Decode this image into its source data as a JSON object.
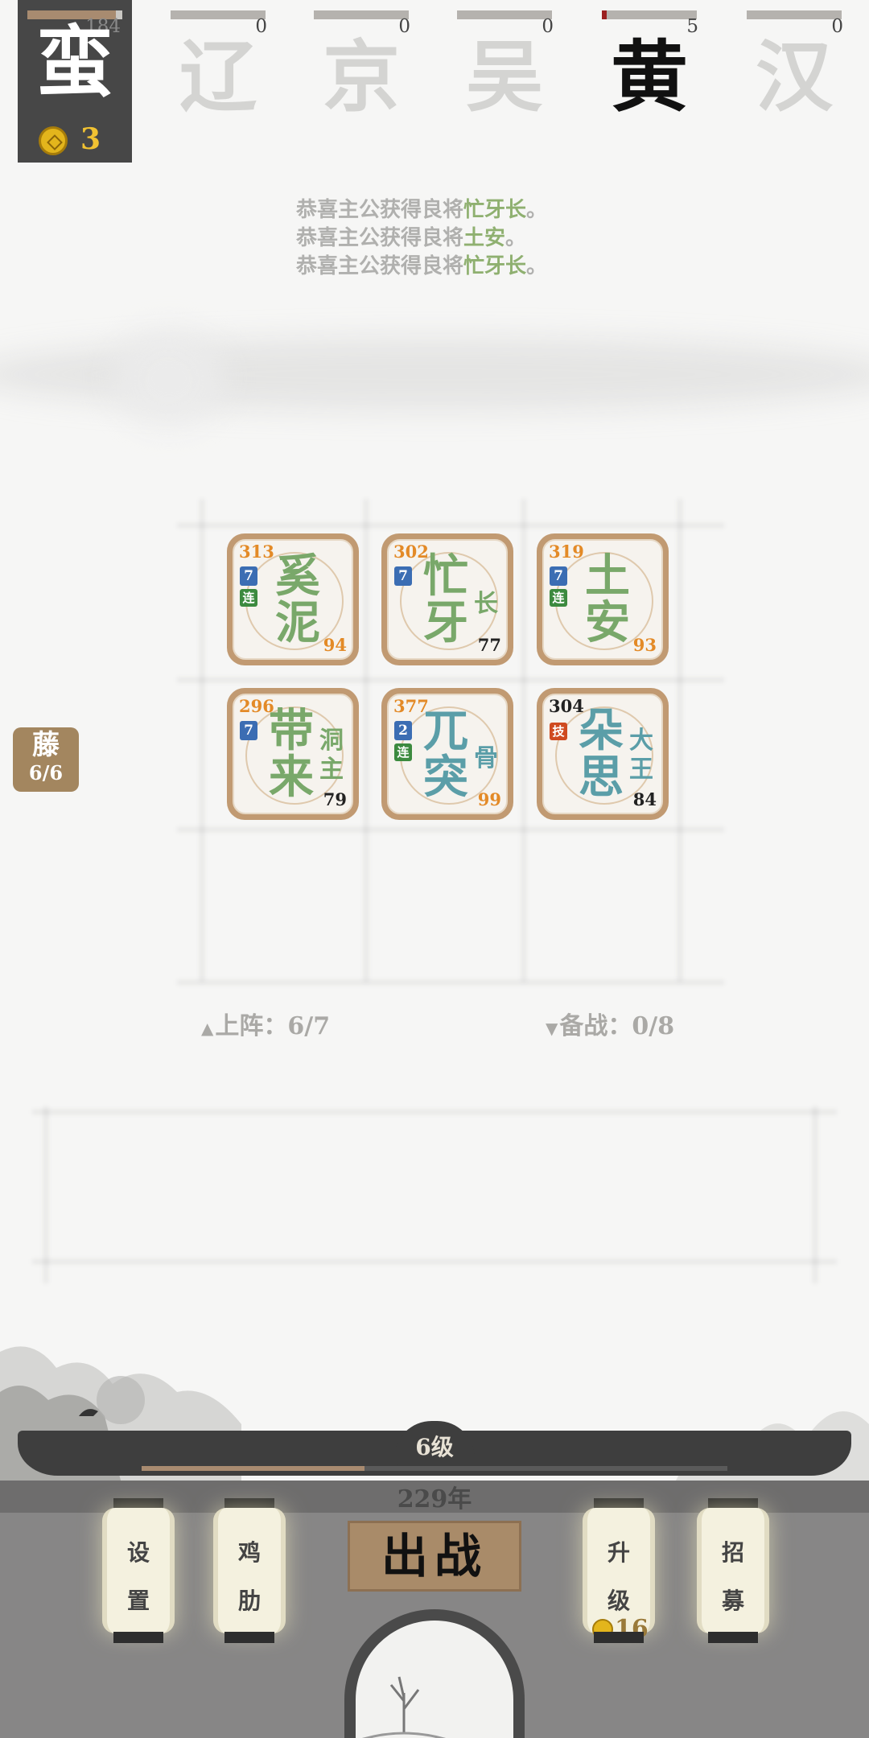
{
  "factions": [
    {
      "name": "蛮",
      "count": "184",
      "fill": 0.93,
      "selected": true
    },
    {
      "name": "辽",
      "count": "0",
      "fill": 0
    },
    {
      "name": "京",
      "count": "0",
      "fill": 0
    },
    {
      "name": "吴",
      "count": "0",
      "fill": 0
    },
    {
      "name": "黄",
      "count": "5",
      "fill": 0.05
    },
    {
      "name": "汉",
      "count": "0",
      "fill": 0
    }
  ],
  "gold": "3",
  "log": {
    "prefix": "恭喜主公获得良将",
    "suffix": "。",
    "entries": [
      {
        "name": "忙牙长"
      },
      {
        "name": "土安"
      },
      {
        "name": "忙牙长"
      }
    ]
  },
  "cards": [
    {
      "hp": "313",
      "level": "7",
      "tag": "连",
      "name_1": "奚",
      "name_2": "泥",
      "subtitle_1": "",
      "subtitle_2": "",
      "attack": "94",
      "color": "green"
    },
    {
      "hp": "302",
      "level": "7",
      "tag": "",
      "name_1": "忙",
      "name_2": "牙",
      "subtitle_1": "长",
      "subtitle_2": "",
      "attack": "77",
      "color": "green"
    },
    {
      "hp": "319",
      "level": "7",
      "tag": "连",
      "name_1": "土",
      "name_2": "安",
      "subtitle_1": "",
      "subtitle_2": "",
      "attack": "93",
      "color": "green"
    },
    {
      "hp": "296",
      "level": "7",
      "tag": "",
      "name_1": "带",
      "name_2": "来",
      "subtitle_1": "洞",
      "subtitle_2": "主",
      "attack": "79",
      "color": "green"
    },
    {
      "hp": "377",
      "level": "2",
      "tag": "连",
      "name_1": "兀",
      "name_2": "突",
      "subtitle_1": "骨",
      "subtitle_2": "",
      "attack": "99",
      "color": "teal"
    },
    {
      "hp": "304",
      "level": "",
      "tag": "技",
      "name_1": "朵",
      "name_2": "思",
      "subtitle_1": "大",
      "subtitle_2": "王",
      "attack": "84",
      "color": "teal"
    }
  ],
  "reserve": {
    "name": "藤",
    "count": "6/6"
  },
  "deployed": {
    "label": "上阵：6/7"
  },
  "standby": {
    "label": "备战：0/8"
  },
  "level": "6级",
  "xp_fill": 0.38,
  "year": "229年",
  "buttons": {
    "settings": [
      "设",
      "置"
    ],
    "assist": [
      "鸡",
      "肋"
    ],
    "battle": "出战",
    "upgrade": [
      "升",
      "级"
    ],
    "upgrade_cost": "16",
    "recruit": [
      "招",
      "募"
    ]
  },
  "colors": {
    "accent_brown": "#a98b69",
    "hp_orange": "#e38a27",
    "name_green": "#79a86a",
    "name_teal": "#5b9ea8",
    "level_blue": "#3b6db3",
    "tag_green": "#3c8a3f",
    "tag_red": "#cf4a20"
  }
}
